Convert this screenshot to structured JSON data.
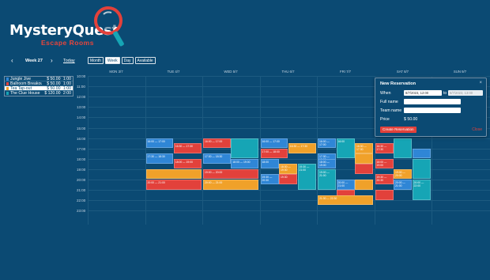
{
  "brand": {
    "title": "MysteryQuest",
    "subtitle": "Escape Rooms"
  },
  "nav": {
    "prev_icon": "chevron-left-icon",
    "next_icon": "chevron-right-icon",
    "week_label": "Week 27",
    "today_label": "Today"
  },
  "views": [
    {
      "label": "Month",
      "active": false
    },
    {
      "label": "Week",
      "active": true
    },
    {
      "label": "Day",
      "active": false
    },
    {
      "label": "Available",
      "active": false
    }
  ],
  "rooms": [
    {
      "name": "Jungle Jive",
      "price": "$ 50.00",
      "duration": "1:00",
      "color": "#2f86d6",
      "selected": false
    },
    {
      "name": "Ballroom Breakout",
      "price": "$ 50.00",
      "duration": "1:00",
      "color": "#e2413b",
      "selected": false
    },
    {
      "name": "Tea Tap-out",
      "price": "$ 50.00",
      "duration": "1:00",
      "color": "#f0a12a",
      "selected": true
    },
    {
      "name": "The Clue House",
      "price": "$ 120.00",
      "duration": "2:00",
      "color": "#16a5b5",
      "selected": false
    }
  ],
  "calendar": {
    "days": [
      "MON 3/7",
      "TUE 4/7",
      "WED 5/7",
      "THU 6/7",
      "FRI 7/7",
      "SAT 8/7",
      "SUN 9/7"
    ],
    "hours": [
      "10:00",
      "11:00",
      "12:00",
      "13:00",
      "14:00",
      "15:00",
      "16:00",
      "17:00",
      "18:00",
      "19:00",
      "20:00",
      "21:00",
      "22:00",
      "23:00"
    ],
    "events": [
      {
        "day": 1,
        "start": 16.0,
        "end": 17.0,
        "lane": 0,
        "lanes": 2,
        "color": "blue",
        "text": "16:00 — 17:00"
      },
      {
        "day": 1,
        "start": 16.5,
        "end": 17.5,
        "lane": 1,
        "lanes": 2,
        "color": "red",
        "text": "16:30 — 17:30"
      },
      {
        "day": 1,
        "start": 17.5,
        "end": 18.5,
        "lane": 0,
        "lanes": 2,
        "color": "blue",
        "text": "17:30 — 18:30"
      },
      {
        "day": 1,
        "start": 18.0,
        "end": 19.0,
        "lane": 1,
        "lanes": 2,
        "color": "red",
        "text": "18:00 — 19:00"
      },
      {
        "day": 1,
        "start": 19.0,
        "end": 20.0,
        "lane": 0,
        "lanes": 1,
        "color": "orange",
        "text": ""
      },
      {
        "day": 1,
        "start": 20.0,
        "end": 21.0,
        "lane": 0,
        "lanes": 1,
        "color": "red",
        "text": "20:00 — 21:00"
      },
      {
        "day": 2,
        "start": 16.0,
        "end": 17.0,
        "lane": 0,
        "lanes": 2,
        "color": "red",
        "text": "16:00 — 17:00"
      },
      {
        "day": 2,
        "start": 16.0,
        "end": 18.0,
        "lane": 1,
        "lanes": 2,
        "color": "teal",
        "text": ""
      },
      {
        "day": 2,
        "start": 17.5,
        "end": 18.5,
        "lane": 0,
        "lanes": 2,
        "color": "blue",
        "text": "17:30 — 18:30"
      },
      {
        "day": 2,
        "start": 18.0,
        "end": 19.0,
        "lane": 1,
        "lanes": 2,
        "color": "blue",
        "text": "18:00 — 19:00"
      },
      {
        "day": 2,
        "start": 19.0,
        "end": 20.0,
        "lane": 0,
        "lanes": 1,
        "color": "red",
        "text": "19:00 — 20:00"
      },
      {
        "day": 2,
        "start": 20.0,
        "end": 21.0,
        "lane": 0,
        "lanes": 1,
        "color": "orange",
        "text": "20:00 — 21:00"
      },
      {
        "day": 3,
        "start": 16.0,
        "end": 17.0,
        "lane": 0,
        "lanes": 2,
        "color": "blue",
        "text": "16:00 — 17:00"
      },
      {
        "day": 3,
        "start": 16.5,
        "end": 17.5,
        "lane": 1,
        "lanes": 2,
        "color": "orange",
        "text": "16:30 — 17:30"
      },
      {
        "day": 3,
        "start": 17.0,
        "end": 18.0,
        "lane": 0,
        "lanes": 2,
        "color": "red",
        "text": "17:00 — 18:00"
      },
      {
        "day": 3,
        "start": 18.0,
        "end": 19.0,
        "lane": 0,
        "lanes": 3,
        "color": "blue",
        "text": "18:00"
      },
      {
        "day": 3,
        "start": 18.5,
        "end": 19.5,
        "lane": 1,
        "lanes": 3,
        "color": "orange",
        "text": "18:30 — 19:30"
      },
      {
        "day": 3,
        "start": 18.5,
        "end": 20.5,
        "lane": 2,
        "lanes": 3,
        "color": "teal",
        "text": ""
      },
      {
        "day": 3,
        "start": 19.5,
        "end": 20.5,
        "lane": 0,
        "lanes": 3,
        "color": "blue",
        "text": "19:30 — 20:30"
      },
      {
        "day": 3,
        "start": 19.5,
        "end": 20.5,
        "lane": 1,
        "lanes": 3,
        "color": "red",
        "text": "19:30"
      },
      {
        "day": 3,
        "start": 18.5,
        "end": 21.0,
        "lane": 2,
        "lanes": 3,
        "color": "teal",
        "text": "19:30 — 21:00"
      },
      {
        "day": 4,
        "start": 16.0,
        "end": 17.0,
        "lane": 0,
        "lanes": 3,
        "color": "blue",
        "text": "16:00 — 17:00"
      },
      {
        "day": 4,
        "start": 16.0,
        "end": 18.0,
        "lane": 1,
        "lanes": 3,
        "color": "teal",
        "text": "16:00"
      },
      {
        "day": 4,
        "start": 16.5,
        "end": 17.5,
        "lane": 2,
        "lanes": 3,
        "color": "orange",
        "text": "16:30 — 17:30"
      },
      {
        "day": 4,
        "start": 17.5,
        "end": 18.5,
        "lane": 0,
        "lanes": 3,
        "color": "blue",
        "text": "17:30 — 18:30"
      },
      {
        "day": 4,
        "start": 17.5,
        "end": 18.5,
        "lane": 2,
        "lanes": 3,
        "color": "orange",
        "text": ""
      },
      {
        "day": 4,
        "start": 18.0,
        "end": 19.0,
        "lane": 0,
        "lanes": 3,
        "color": "blue",
        "text": "18:00 — 19:00"
      },
      {
        "day": 4,
        "start": 18.5,
        "end": 19.5,
        "lane": 2,
        "lanes": 3,
        "color": "red",
        "text": ""
      },
      {
        "day": 4,
        "start": 19.0,
        "end": 21.0,
        "lane": 0,
        "lanes": 3,
        "color": "teal",
        "text": "19:00 — 21:00"
      },
      {
        "day": 4,
        "start": 20.0,
        "end": 21.0,
        "lane": 1,
        "lanes": 3,
        "color": "blue",
        "text": "20:00 — 21:00"
      },
      {
        "day": 4,
        "start": 20.0,
        "end": 21.0,
        "lane": 2,
        "lanes": 3,
        "color": "orange",
        "text": ""
      },
      {
        "day": 4,
        "start": 21.0,
        "end": 22.0,
        "lane": 1,
        "lanes": 3,
        "color": "red",
        "text": ""
      },
      {
        "day": 4,
        "start": 21.5,
        "end": 22.5,
        "lane": 0,
        "lanes": 1,
        "color": "orange",
        "text": "21:30 — 22:30"
      },
      {
        "day": 5,
        "start": 16.5,
        "end": 17.5,
        "lane": 0,
        "lanes": 3,
        "color": "red",
        "text": "16:30 — 17:30"
      },
      {
        "day": 5,
        "start": 16.0,
        "end": 18.0,
        "lane": 1,
        "lanes": 3,
        "color": "teal",
        "text": ""
      },
      {
        "day": 5,
        "start": 17.0,
        "end": 18.0,
        "lane": 2,
        "lanes": 3,
        "color": "blue",
        "text": ""
      },
      {
        "day": 5,
        "start": 18.0,
        "end": 19.0,
        "lane": 0,
        "lanes": 3,
        "color": "red",
        "text": "18:00 — 19:00"
      },
      {
        "day": 5,
        "start": 18.0,
        "end": 20.0,
        "lane": 2,
        "lanes": 3,
        "color": "teal",
        "text": ""
      },
      {
        "day": 5,
        "start": 19.0,
        "end": 20.0,
        "lane": 1,
        "lanes": 3,
        "color": "orange",
        "text": "19:00 — 20:00"
      },
      {
        "day": 5,
        "start": 19.5,
        "end": 20.5,
        "lane": 0,
        "lanes": 3,
        "color": "red",
        "text": "19:30 — 20:30"
      },
      {
        "day": 5,
        "start": 20.0,
        "end": 21.0,
        "lane": 1,
        "lanes": 3,
        "color": "blue",
        "text": "20:00 — 21:00"
      },
      {
        "day": 5,
        "start": 20.0,
        "end": 22.0,
        "lane": 2,
        "lanes": 3,
        "color": "teal",
        "text": "20:00 — 22:00"
      },
      {
        "day": 5,
        "start": 21.0,
        "end": 22.0,
        "lane": 0,
        "lanes": 3,
        "color": "red",
        "text": ""
      }
    ]
  },
  "popup": {
    "title": "New Reservation",
    "close_icon": "close-icon",
    "when_label": "When",
    "when_from": "8/7/2023, 12:00",
    "to_label": "to",
    "when_to": "8/7/2023, 13:00",
    "fullname_label": "Full name",
    "teamname_label": "Team name",
    "price_label": "Price",
    "price_value": "$ 50.00",
    "create_label": "Create Reservation",
    "close_label": "Close"
  }
}
